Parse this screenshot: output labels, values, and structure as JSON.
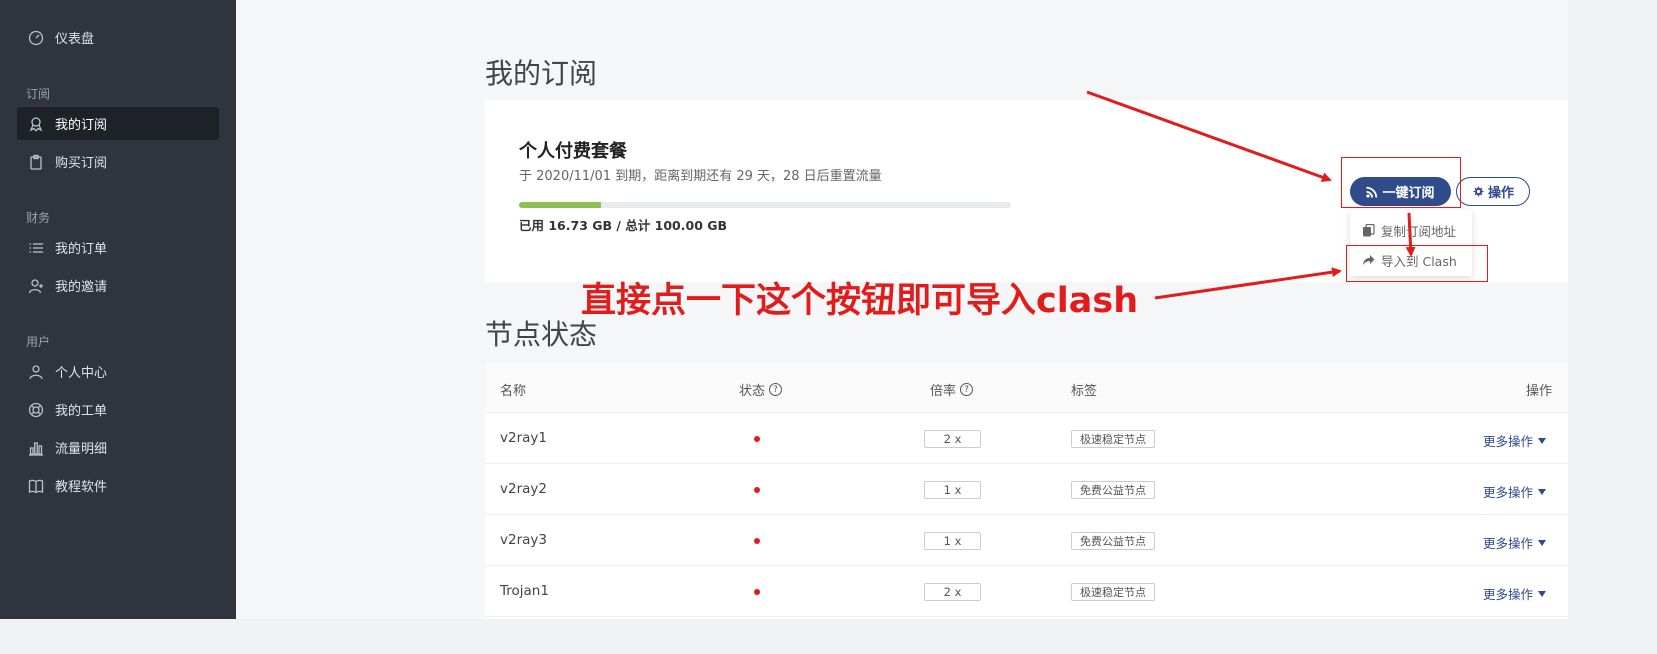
{
  "sidebar": {
    "dashboard": "仪表盘",
    "sections": {
      "subscription": "订阅",
      "finance": "财务",
      "user": "用户"
    },
    "items": {
      "my_subscription": "我的订阅",
      "buy_subscription": "购买订阅",
      "my_orders": "我的订单",
      "my_invites": "我的邀请",
      "user_center": "个人中心",
      "my_tickets": "我的工单",
      "traffic_detail": "流量明细",
      "tutorial_software": "教程软件"
    },
    "icons": [
      "dashboard-icon",
      "ribbon-icon",
      "clipboard-icon",
      "list-icon",
      "user-plus-icon",
      "user-icon",
      "lifebuoy-icon",
      "bar-chart-icon",
      "book-icon"
    ]
  },
  "main": {
    "page_title": "我的订阅",
    "plan": {
      "name": "个人付费套餐",
      "subtitle": "于 2020/11/01 到期，距离到期还有 29 天，28 日后重置流量",
      "usage": "已用 16.73 GB / 总计 100.00 GB",
      "progress": 0.1673,
      "progress_color": "#8cc152"
    },
    "buttons": {
      "subscribe": "一键订阅",
      "operate": "操作"
    },
    "dropdown": {
      "copy": "复制订阅地址",
      "import": "导入到 Clash"
    },
    "node_section_title": "节点状态",
    "table": {
      "headers": {
        "name": "名称",
        "status": "状态",
        "rate": "倍率",
        "tags": "标签",
        "action": "操作"
      },
      "help_glyph": "?",
      "rows": [
        {
          "name": "v2ray1",
          "rate": "2 x",
          "tag": "极速稳定节点",
          "action": "更多操作"
        },
        {
          "name": "v2ray2",
          "rate": "1 x",
          "tag": "免费公益节点",
          "action": "更多操作"
        },
        {
          "name": "v2ray3",
          "rate": "1 x",
          "tag": "免费公益节点",
          "action": "更多操作"
        },
        {
          "name": "Trojan1",
          "rate": "2 x",
          "tag": "极速稳定节点",
          "action": "更多操作"
        }
      ]
    }
  },
  "annotation": {
    "text": "直接点一下这个按钮即可导入clash",
    "color": "#e21b1b"
  },
  "colors": {
    "sidebar_bg": "#2f343f",
    "accent": "#2f4b8a",
    "status_offline": "#e21b1b"
  }
}
